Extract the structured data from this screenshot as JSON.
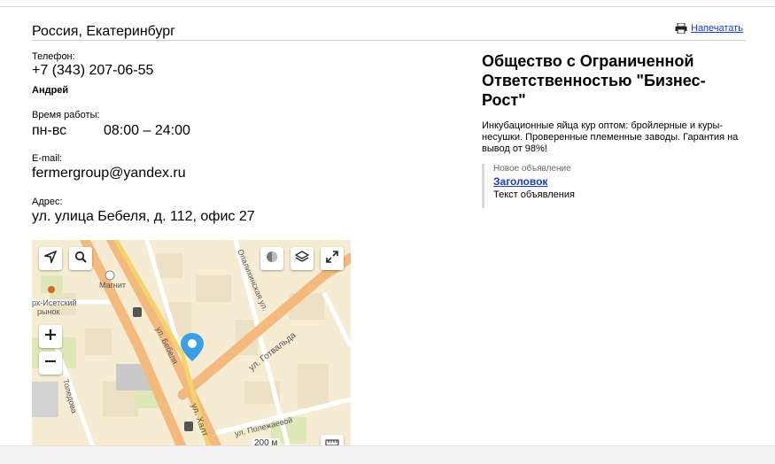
{
  "header": {
    "city": "Россия, Екатеринбург",
    "print_label": "Напечатать",
    "print_icon": "printer-icon"
  },
  "contacts": {
    "phone_label": "Телефон:",
    "phone": "+7 (343) 207-06-55",
    "contact_person": "Андрей",
    "hours_label": "Время работы:",
    "hours_days": "пн-вс",
    "hours_time": "08:00 – 24:00",
    "email_label": "E-mail:",
    "email": "fermergroup@yandex.ru",
    "address_label": "Адрес:",
    "address": "ул. улица Бебеля, д. 112, офис 27"
  },
  "map": {
    "labels": {
      "magnit": "Магнит",
      "market_line1": "рх-Исетский",
      "market_line2": "рынок",
      "opalikha": "Опалихинская ул.",
      "gotvalda": "ул. Готвальда",
      "bebelya": "ул. Бебеля",
      "polezhaevoy": "ул. Полежаевой",
      "toledova": "Толедова",
      "khalt": "ул. Халт"
    },
    "scale": "200 м",
    "controls": [
      "locate-icon",
      "search-icon",
      "traffic-icon",
      "layers-icon",
      "fullscreen-icon",
      "zoom-in-icon",
      "zoom-out-icon",
      "ruler-icon"
    ],
    "colors": {
      "background": "#f5ecd3",
      "major_road": "#f4b97c",
      "minor_road": "#ffffff",
      "pin": "#3b9fe8"
    }
  },
  "company": {
    "name": "Общество с Ограниченной Ответственностью \"Бизнес-Рост\"",
    "description": "Инкубационные яйца кур оптом: бройлерные и куры-несушки. Проверенные племенные заводы. Гарантия на вывод от 98%!"
  },
  "ad": {
    "label": "Новое объявление",
    "title": "Заголовок",
    "text": "Текст объявления"
  },
  "colors": {
    "link": "#1a3dc1",
    "rule": "#d0d0d0"
  }
}
